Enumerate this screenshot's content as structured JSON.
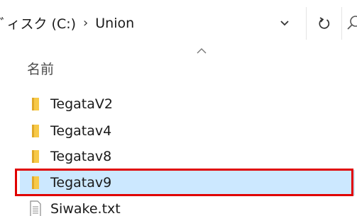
{
  "address_bar": {
    "drive_label": "ﾞィスク (C:)",
    "separator": "›",
    "current_folder": "Union"
  },
  "column_header": {
    "name_label": "名前"
  },
  "files": [
    {
      "name": "TegataV2",
      "type": "folder",
      "selected": false
    },
    {
      "name": "Tegatav4",
      "type": "folder",
      "selected": false
    },
    {
      "name": "Tegatav8",
      "type": "folder",
      "selected": false
    },
    {
      "name": "Tegatav9",
      "type": "folder",
      "selected": true
    },
    {
      "name": "Siwake.txt",
      "type": "text-file",
      "selected": false
    }
  ],
  "colors": {
    "folder": "#f7c948",
    "folder_shadow": "#e0a92a",
    "selection_bg": "#cce8ff",
    "highlight_border": "#e00000"
  },
  "icons": {
    "dropdown": "chevron-down-icon",
    "refresh": "refresh-icon",
    "search": "search-icon",
    "sort": "sort-ascending-icon",
    "folder": "folder-icon",
    "text_file": "text-file-icon"
  }
}
